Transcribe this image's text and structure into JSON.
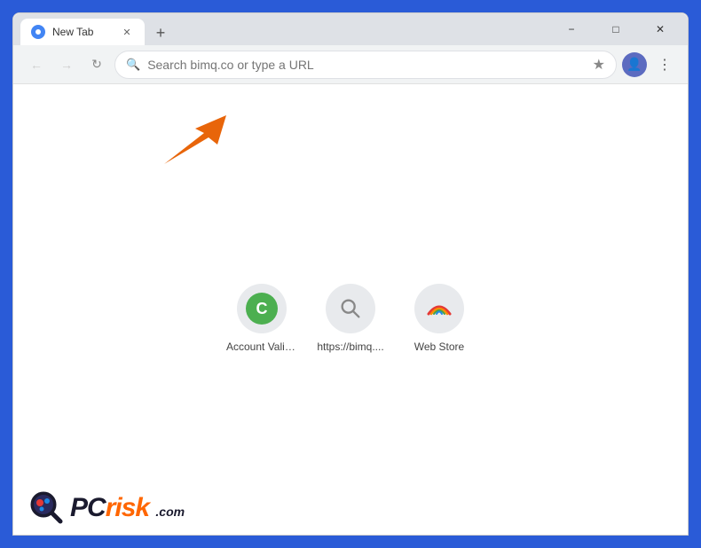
{
  "browser": {
    "tab": {
      "title": "New Tab",
      "favicon_alt": "chrome-icon"
    },
    "new_tab_button_label": "+",
    "window_controls": {
      "minimize": "−",
      "maximize": "□",
      "close": "✕"
    },
    "toolbar": {
      "back_title": "Back",
      "forward_title": "Forward",
      "reload_title": "Reload",
      "address_placeholder": "Search bimq.co or type a URL",
      "bookmark_title": "Bookmark",
      "profile_letter": "👤",
      "menu_title": "Menu"
    },
    "shortcuts": [
      {
        "id": "account-valid",
        "label": "Account Valid...",
        "type": "letter",
        "letter": "C"
      },
      {
        "id": "bimq",
        "label": "https://bimq....",
        "type": "search"
      },
      {
        "id": "webstore",
        "label": "Web Store",
        "type": "webstore"
      }
    ]
  },
  "watermark": {
    "pc": "PC",
    "risk": "risk",
    "dotcom": ".com"
  },
  "colors": {
    "accent": "#ff6600",
    "browser_border": "#2a5bd7"
  }
}
